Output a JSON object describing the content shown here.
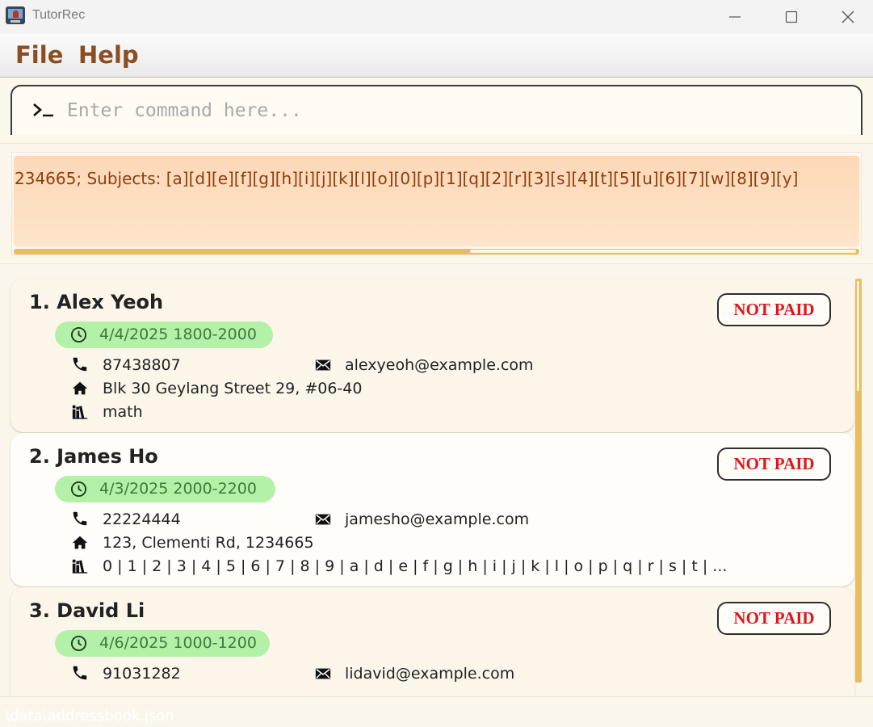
{
  "window": {
    "title": "TutorRec",
    "icons": {
      "app": "tutor-app-icon",
      "minimize": "minimize-icon",
      "maximize": "maximize-icon",
      "close": "close-icon"
    }
  },
  "menu": {
    "file_label": "File",
    "help_label": "Help"
  },
  "command": {
    "placeholder": "Enter command here...",
    "value": "",
    "icon": "terminal-prompt-icon"
  },
  "result": {
    "text": "234665; Subjects: [a][d][e][f][g][h][i][j][k][l][o][0][p][1][q][2][r][3][s][4][t][5][u][6][7][w][8][9][y]"
  },
  "persons": [
    {
      "name": "1. Alex Yeoh",
      "lesson": "4/4/2025 1800-2000",
      "payment": "NOT PAID",
      "phone": "87438807",
      "email": "alexyeoh@example.com",
      "address": "Blk 30 Geylang Street 29, #06-40",
      "subjects": "math"
    },
    {
      "name": "2. James Ho",
      "lesson": "4/3/2025 2000-2200",
      "payment": "NOT PAID",
      "phone": "22224444",
      "email": "jamesho@example.com",
      "address": "123, Clementi Rd, 1234665",
      "subjects": "0 | 1 | 2 | 3 | 4 | 5 | 6 | 7 | 8 | 9 | a | d | e | f | g | h | i | j | k | l | o | p | q | r | s | t | ..."
    },
    {
      "name": "3. David Li",
      "lesson": "4/6/2025 1000-1200",
      "payment": "NOT PAID",
      "phone": "91031282",
      "email": "lidavid@example.com"
    }
  ],
  "status": {
    "path": "\\data\\addressbook.json"
  },
  "colors": {
    "menu_text": "#8a4e22",
    "lesson_bg": "#b3f1a9",
    "lesson_text": "#3d7a3a",
    "not_paid": "#e0141a",
    "scrollbar": "#e6bd63",
    "result_bg": "#fdd8b6"
  }
}
